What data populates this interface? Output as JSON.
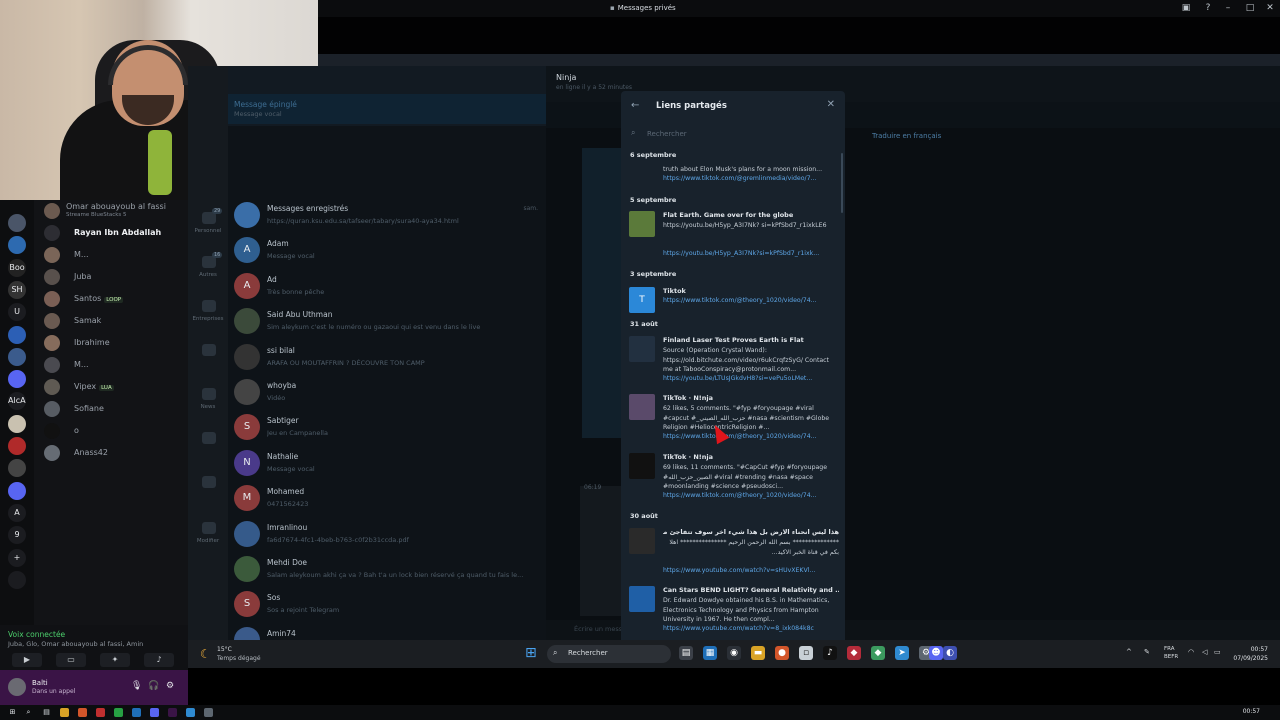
{
  "window": {
    "title": "Messages privés"
  },
  "colors": {
    "link": "#5ea7e8",
    "voice_green": "#4ccf6c",
    "cursor": "#e0151b",
    "panel_bg": "#18222c",
    "user_bar": "#3a1446"
  },
  "discord": {
    "servers": [
      "",
      "",
      "Boo",
      "SH",
      "U",
      "",
      "",
      "",
      "AlcAg",
      "",
      "",
      "",
      "",
      "A",
      "9",
      "+",
      ""
    ],
    "members": [
      {
        "name": "Omar abouayoub al fassi",
        "sub": "Streame BlueStacks 5",
        "tag": ""
      },
      {
        "name": "Rayan Ibn Abdallah",
        "sub": "",
        "tag": ""
      },
      {
        "name": "M...",
        "sub": "",
        "tag": ""
      },
      {
        "name": "Juba",
        "sub": "",
        "tag": ""
      },
      {
        "name": "Santos",
        "sub": "",
        "tag": "LOOP"
      },
      {
        "name": "Samak",
        "sub": "",
        "tag": ""
      },
      {
        "name": "Ibrahime",
        "sub": "",
        "tag": ""
      },
      {
        "name": "M...",
        "sub": "",
        "tag": ""
      },
      {
        "name": "Vipex",
        "sub": "",
        "tag": "LUA"
      },
      {
        "name": "Sofiane",
        "sub": "",
        "tag": ""
      },
      {
        "name": "o",
        "sub": "",
        "tag": ""
      },
      {
        "name": "Anass42",
        "sub": "",
        "tag": ""
      }
    ],
    "voice": {
      "status": "Voix connectée",
      "participants": "Juba, Glo, Omar abouayoub al fassi, Amin"
    },
    "user": {
      "name": "Balti",
      "sub": "Dans un appel"
    }
  },
  "telegram": {
    "folders": [
      {
        "label": "Personnel",
        "badge": "29"
      },
      {
        "label": "Autres",
        "badge": "16"
      },
      {
        "label": "Entreprises",
        "badge": ""
      },
      {
        "label": "",
        "badge": ""
      },
      {
        "label": "News",
        "badge": ""
      },
      {
        "label": "",
        "badge": ""
      },
      {
        "label": "",
        "badge": ""
      },
      {
        "label": "Modifier",
        "badge": ""
      }
    ],
    "pinned_label": "Message épinglé",
    "pinned_sub": "Message vocal",
    "chats": [
      {
        "initial": "",
        "name": "Messages enregistrés",
        "msg": "https://quran.ksu.edu.sa/tafseer/tabary/sura40-aya34.html",
        "time": "sam."
      },
      {
        "initial": "A",
        "name": "Adam",
        "msg": "Message vocal",
        "time": ""
      },
      {
        "initial": "A",
        "name": "Ad",
        "msg": "Très bonne pêche",
        "time": ""
      },
      {
        "initial": "",
        "name": "Said Abu Uthman",
        "msg": "Sim aleykum c'est le numéro ou gazaoui qui est venu dans le live",
        "time": ""
      },
      {
        "initial": "",
        "name": "ssi bilal",
        "msg": "ARAFA OU MOUTAFFRIN ? DÉCOUVRE TON CAMP",
        "time": ""
      },
      {
        "initial": "",
        "name": "whoyba",
        "msg": "Vidéo",
        "time": ""
      },
      {
        "initial": "S",
        "name": "Sabtiger",
        "msg": "Jeu en Campanella",
        "time": ""
      },
      {
        "initial": "N",
        "name": "Nathalie",
        "msg": "Message vocal",
        "time": ""
      },
      {
        "initial": "M",
        "name": "Mohamed",
        "msg": "0471562423",
        "time": ""
      },
      {
        "initial": "",
        "name": "Imranlinou",
        "msg": "fa6d7674-4fc1-4beb-b763-c0f2b31ccda.pdf",
        "time": ""
      },
      {
        "initial": "",
        "name": "Mehdi Doe",
        "msg": "Salam aleykoum akhi ça va ? Bah t'a un lock bien réservé ça quand tu fais le...",
        "time": ""
      },
      {
        "initial": "S",
        "name": "Sos",
        "msg": "Sos a rejoint Telegram",
        "time": ""
      },
      {
        "initial": "",
        "name": "Amin74",
        "msg": "",
        "time": ""
      }
    ],
    "conversation": {
      "name": "Ninja",
      "sub": "en ligne il y a 52 minutes",
      "translate": "Traduire en français",
      "input_placeholder": "Écrire un message...",
      "time1": "06:19"
    },
    "shared_links": {
      "title": "Liens partagés",
      "search_placeholder": "Rechercher",
      "groups": [
        {
          "date": "6 septembre",
          "items": [
            {
              "title": "",
              "thumb": "",
              "desc": "truth about Elon Musk's plans for a moon mission...",
              "url": "https://www.tiktok.com/@gremlinmedia/video/7..."
            }
          ]
        },
        {
          "date": "5 septembre",
          "items": [
            {
              "title": "Flat Earth. Game over for the globe",
              "thumb": "",
              "desc": "https://youtu.be/H5yp_A3I7Nk? si=kPfSbd7_r1ixkLE6",
              "url": "https://youtu.be/H5yp_A3I7Nk?si=kPfSbd7_r1ixk..."
            }
          ]
        },
        {
          "date": "3 septembre",
          "items": [
            {
              "title": "Tiktok",
              "thumb": "T",
              "desc": "",
              "url": "https://www.tiktok.com/@theory_1020/video/74..."
            }
          ]
        },
        {
          "date": "31 août",
          "items": [
            {
              "title": "Finland Laser Test Proves Earth is Flat",
              "thumb": "",
              "desc": "Source (Operation Crystal Wand): https://old.bitchute.com/video/r6ukCrqfzSyG/ Contact me at TabooConspiracy@protonmail.com...",
              "url": "https://youtu.be/LTUsJGkdvH8?si=vePu5oLMet..."
            },
            {
              "title": "TikTok · N!nja",
              "thumb": "",
              "desc": "62 likes, 5 comments. \"#fyp #foryoupage #viral #capcut #_حزب_الله_الصيني #nasa #scientism #Globe Religion #HeliocentricReligion #...",
              "url": "https://www.tiktok.com/@theory_1020/video/74..."
            },
            {
              "title": "TikTok · N!nja",
              "thumb": "",
              "desc": "69 likes, 11 comments. \"#CapCut #fyp #foryoupage #الصين_حزب_الله #viral #trending #nasa #space #moonlanding #science #pseudosci...",
              "url": "https://www.tiktok.com/@theory_1020/video/74..."
            }
          ]
        },
        {
          "date": "30 août",
          "items": [
            {
              "title": "هذا ليس انحناء الارض بل هذا شيء اخر سوف تتفاجئ منه",
              "thumb": "",
              "desc": "*************** بسم الله الرحمن الرحيم *************** اهلا بكم في قناة الخبر الاكيد...",
              "url": "https://www.youtube.com/watch?v=sHUvXEKVl..."
            },
            {
              "title": "Can Stars BEND LIGHT? General Relativity and ...",
              "thumb": "",
              "desc": "Dr. Edward Dowdye obtained his B.S. in Mathematics, Electronics Technology and Physics from Hampton University in 1967. He then compl...",
              "url": "https://www.youtube.com/watch?v=8_ixk084k8c"
            }
          ]
        }
      ]
    }
  },
  "taskbar": {
    "weather_temp": "15°C",
    "weather_cond": "Temps dégagé",
    "search_label": "Rechercher",
    "lang_line1": "FRA",
    "lang_line2": "BEFR",
    "time": "00:57",
    "date": "07/09/2025"
  },
  "host_bar": {
    "time": "00:57"
  }
}
